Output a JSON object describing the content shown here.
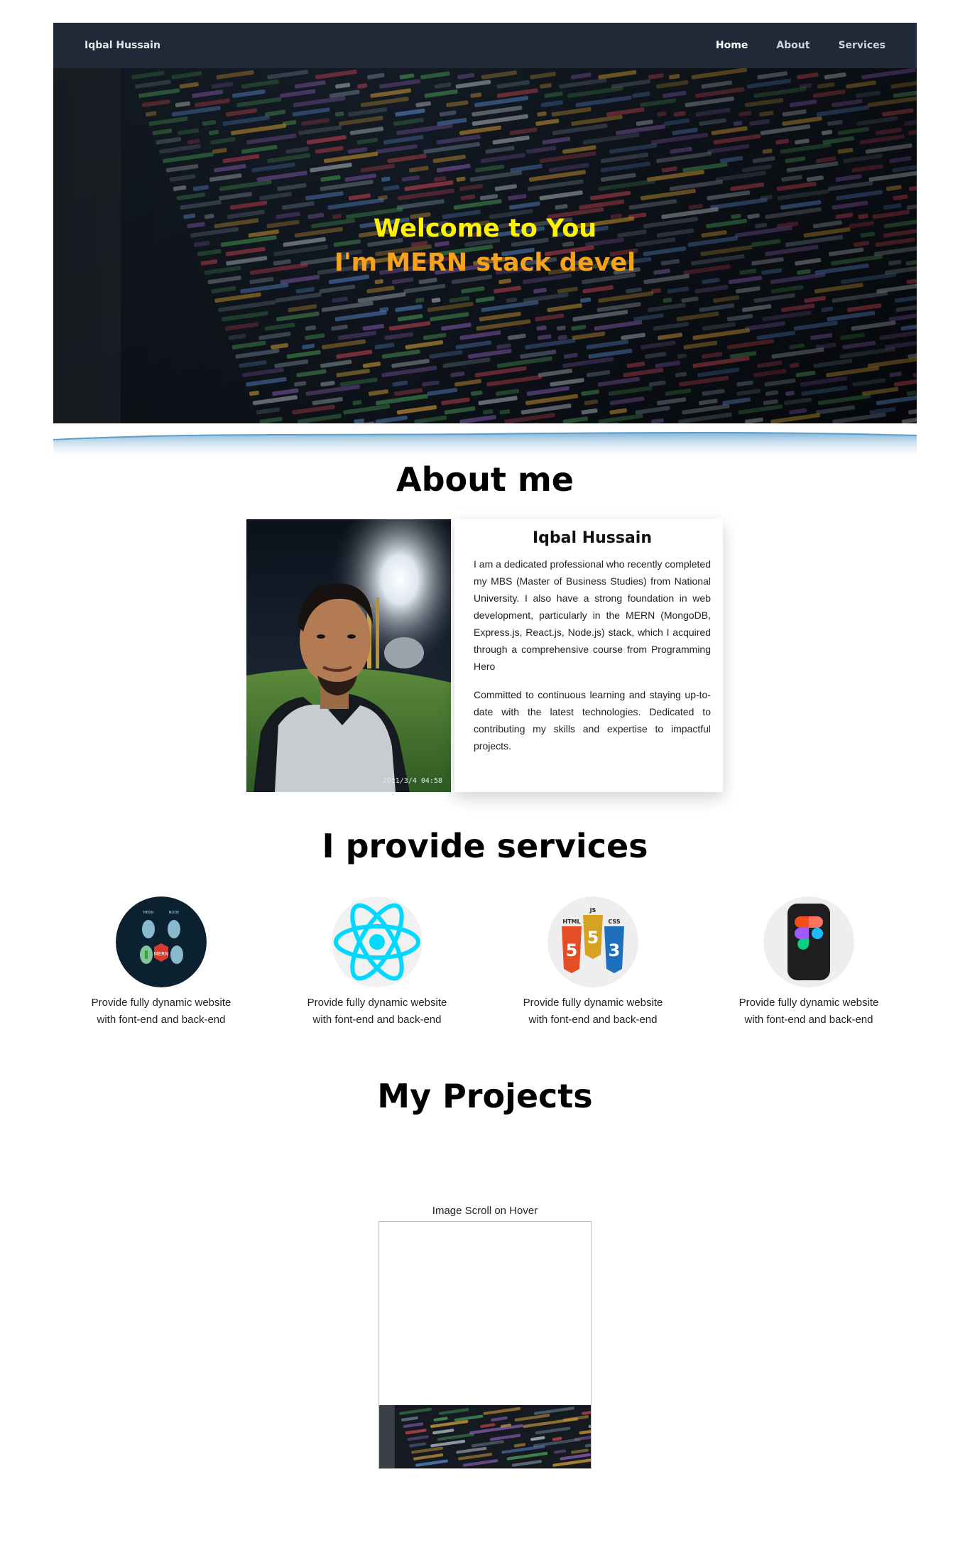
{
  "navbar": {
    "brand": "Iqbal Hussain",
    "links": [
      {
        "label": "Home",
        "active": true
      },
      {
        "label": "About",
        "active": false
      },
      {
        "label": "Services",
        "active": false
      }
    ]
  },
  "hero": {
    "line1": "Welcome to You",
    "line2": "I'm MERN stack devel",
    "colors": {
      "line1": "#fff200",
      "line2": "#f7a21b"
    }
  },
  "about": {
    "title": "About me",
    "photo_stamp": "2021/3/4 04:58",
    "name": "Iqbal Hussain",
    "paragraph1": "I am a dedicated professional who recently completed my MBS (Master of Business Studies) from National University. I also have a strong foundation in web development, particularly in the MERN (MongoDB, Express.js, React.js, Node.js) stack, which I acquired through a comprehensive course from Programming Hero",
    "paragraph2": "Committed to continuous learning and staying up-to-date with the latest technologies. Dedicated to contributing my skills and expertise to impactful projects."
  },
  "services": {
    "title": "I provide services",
    "items": [
      {
        "icon": "mern-stack-icon",
        "description": "Provide fully dynamic website with font-end and back-end"
      },
      {
        "icon": "react-icon",
        "description": "Provide fully dynamic website with font-end and back-end"
      },
      {
        "icon": "html-css-js-icon",
        "description": "Provide fully dynamic website with font-end and back-end"
      },
      {
        "icon": "figma-icon",
        "description": "Provide fully dynamic website with font-end and back-end"
      }
    ]
  },
  "projects": {
    "title": "My Projects",
    "caption": "Image Scroll on Hover"
  },
  "colors": {
    "navbar_bg": "#1f2937",
    "react_blue": "#00d8ff",
    "wave_blue": "#8fbedd"
  }
}
